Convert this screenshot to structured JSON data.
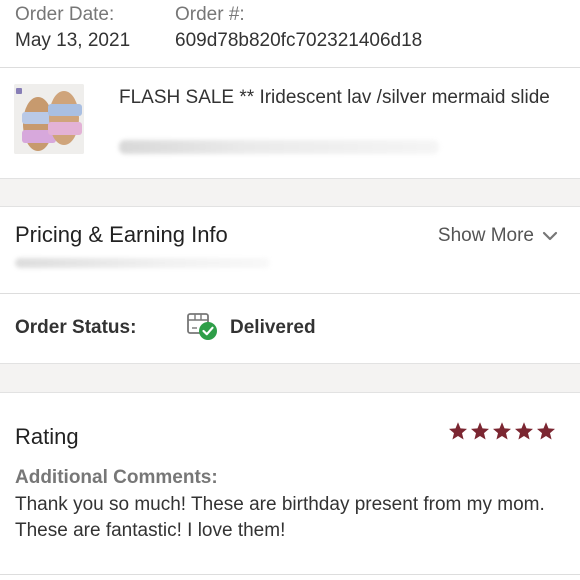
{
  "order": {
    "date_label": "Order Date:",
    "date_value": "May 13, 2021",
    "number_label": "Order #:",
    "number_value": "609d78b820fc702321406d18"
  },
  "product": {
    "title": "FLASH SALE ** Iridescent lav /silver mermaid slide",
    "image": "sandals-thumbnail"
  },
  "pricing": {
    "title": "Pricing & Earning Info",
    "show_more": "Show More",
    "icon": "chevron-down-icon"
  },
  "status": {
    "label": "Order Status:",
    "value": "Delivered",
    "icon": "box-check-icon",
    "accent": "#2e9e48"
  },
  "rating": {
    "title": "Rating",
    "stars": 5,
    "star_color": "#7b2631",
    "comments_label": "Additional Comments:",
    "comments_text": "Thank you so much! These are birthday present from my mom. These are fantastic! I love them!"
  }
}
